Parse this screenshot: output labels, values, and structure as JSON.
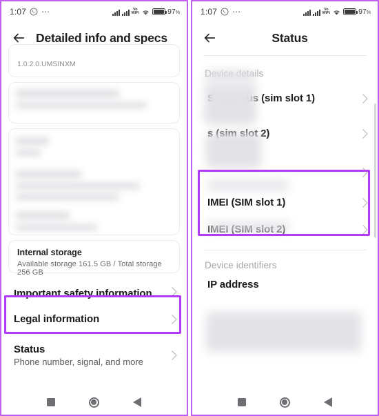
{
  "screens": [
    {
      "id": "detailed-info",
      "statusbar": {
        "time": "1:07",
        "whatsapp_icon": "whatsapp-icon",
        "overflow_icon": "more-dots-icon",
        "signal1_icon": "signal-bars-icon",
        "signal2_icon": "signal-bars-icon",
        "volte_top": "Vo",
        "volte_bottom": "WiFi",
        "wifi_icon": "wifi-icon",
        "battery_icon": "battery-icon",
        "battery_pct": "97",
        "battery_pct_suffix": "%"
      },
      "appbar": {
        "back_icon": "back-arrow-icon",
        "title": "Detailed info and specs"
      },
      "version_text": "1.0.2.0.UMSINXM",
      "storage_card": {
        "title": "Internal storage",
        "subtitle": "Available storage  161.5 GB / Total storage  256 GB"
      },
      "rows": [
        {
          "title": "Important safety information",
          "chevron": "chevron-right-icon"
        },
        {
          "title": "Legal information",
          "chevron": "chevron-right-icon"
        }
      ],
      "status_row": {
        "title": "Status",
        "subtitle": "Phone number, signal, and more",
        "chevron": "chevron-right-icon",
        "highlighted": true
      },
      "navbar": {
        "recents_icon": "square-recents-icon",
        "home_icon": "circle-home-icon",
        "back_icon": "triangle-back-icon"
      }
    },
    {
      "id": "status",
      "statusbar": {
        "time": "1:07",
        "whatsapp_icon": "whatsapp-icon",
        "overflow_icon": "more-dots-icon",
        "signal1_icon": "signal-bars-icon",
        "signal2_icon": "signal-bars-icon",
        "volte_top": "Vo",
        "volte_bottom": "WiFi",
        "wifi_icon": "wifi-icon",
        "battery_icon": "battery-icon",
        "battery_pct": "97",
        "battery_pct_suffix": "%"
      },
      "appbar": {
        "back_icon": "back-arrow-icon",
        "title": "Status"
      },
      "section_device_details": "Device details",
      "device_rows": [
        {
          "title": "SIM status (sim slot 1)",
          "chevron": "chevron-right-icon"
        },
        {
          "title": "s (sim slot 2)",
          "chevron": "chevron-right-icon"
        },
        {
          "title": "",
          "chevron": "chevron-right-icon"
        }
      ],
      "imei_rows": [
        {
          "title": "IMEI (SIM slot 1)",
          "chevron": "chevron-right-icon"
        },
        {
          "title": "IMEI (SIM slot 2)",
          "chevron": "chevron-right-icon"
        }
      ],
      "section_device_identifiers": "Device identifiers",
      "ip_row": {
        "title": "IP address"
      },
      "navbar": {
        "recents_icon": "square-recents-icon",
        "home_icon": "circle-home-icon",
        "back_icon": "triangle-back-icon"
      }
    }
  ],
  "colors": {
    "highlight_purple": "#b43bf5",
    "panel_border": "#c060f0",
    "title_text": "#1a1a1a",
    "muted_text": "#a6a6ab"
  }
}
